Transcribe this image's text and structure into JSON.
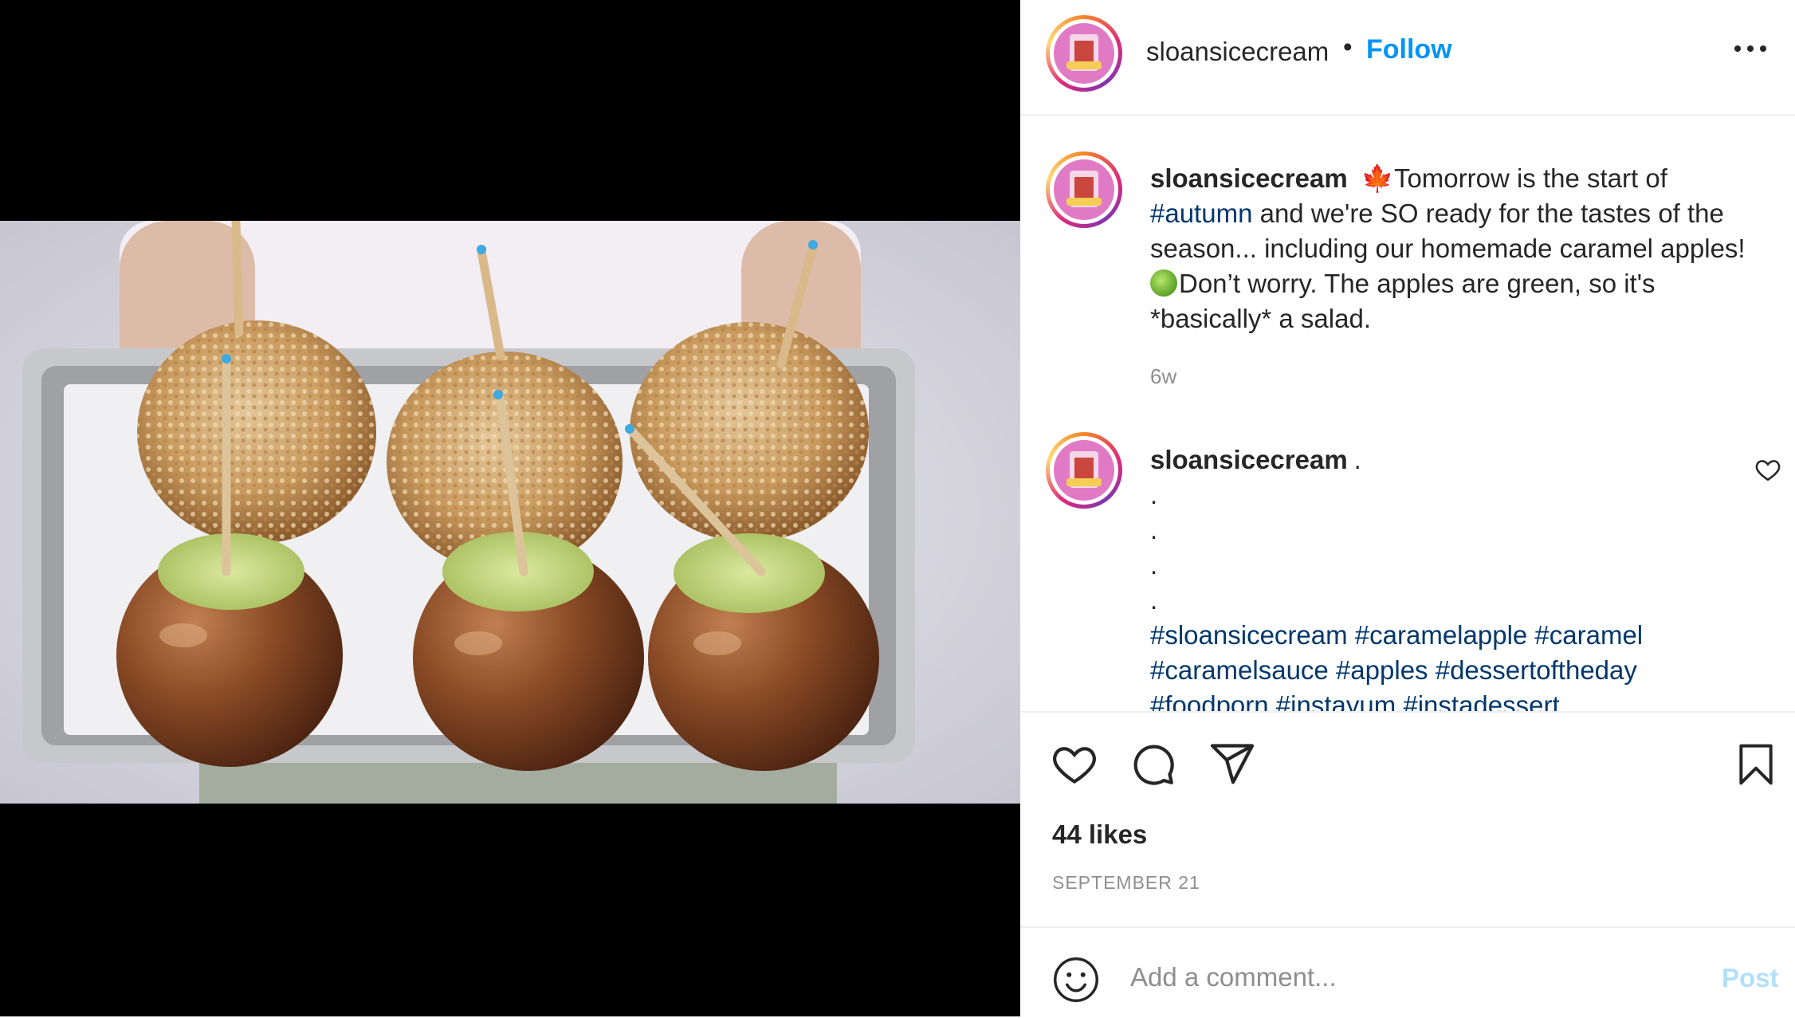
{
  "header": {
    "username": "sloansicecream",
    "separator": "•",
    "follow_label": "Follow",
    "more_icon": "more-horizontal-icon"
  },
  "caption": {
    "username": "sloansicecream",
    "emoji_leaf": "🍁",
    "text_before_tag": "Tomorrow is the start of ",
    "hashtag": "#autumn",
    "text_after_tag": " and we're SO ready for the tastes of the season... including our homemade caramel apples! ",
    "text_end": "Don’t worry. The apples are green, so it's *basically* a salad.",
    "time": "6w"
  },
  "comment": {
    "username": "sloansicecream",
    "lines": [
      ".",
      ".",
      ".",
      ".",
      "."
    ],
    "hashtags": "#sloansicecream #caramelapple #caramel #caramelsauce #apples #dessertoftheday #foodporn #instayum #instadessert"
  },
  "actions": {
    "like_icon": "heart-icon",
    "comment_icon": "comment-icon",
    "share_icon": "paper-plane-icon",
    "save_icon": "bookmark-icon"
  },
  "likes": "44 likes",
  "date": "SEPTEMBER 21",
  "add_comment": {
    "placeholder": "Add a comment...",
    "post_label": "Post"
  },
  "colors": {
    "link": "#0095f6",
    "hashtag": "#00376b",
    "muted": "#8e8e8e",
    "post_disabled": "#b2dffc"
  }
}
